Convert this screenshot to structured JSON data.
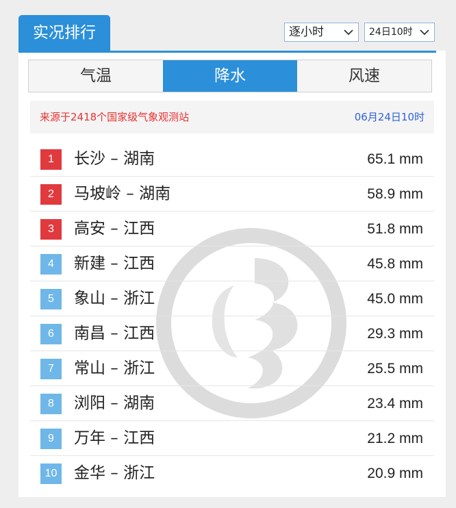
{
  "header": {
    "title": "实况排行",
    "interval_select": "逐小时",
    "time_select": "24日10时"
  },
  "tabs": [
    {
      "label": "气温",
      "active": false
    },
    {
      "label": "降水",
      "active": true
    },
    {
      "label": "风速",
      "active": false
    }
  ],
  "source": {
    "text": "来源于2418个国家级气象观测站",
    "date": "06月24日10时"
  },
  "ranking": [
    {
      "rank": "1",
      "place": "长沙 – 湖南",
      "value": "65.1 mm"
    },
    {
      "rank": "2",
      "place": "马坡岭 – 湖南",
      "value": "58.9 mm"
    },
    {
      "rank": "3",
      "place": "高安 – 江西",
      "value": "51.8 mm"
    },
    {
      "rank": "4",
      "place": "新建 – 江西",
      "value": "45.8 mm"
    },
    {
      "rank": "5",
      "place": "象山 – 浙江",
      "value": "45.0 mm"
    },
    {
      "rank": "6",
      "place": "南昌 – 江西",
      "value": "29.3 mm"
    },
    {
      "rank": "7",
      "place": "常山 – 浙江",
      "value": "25.5 mm"
    },
    {
      "rank": "8",
      "place": "浏阳 – 湖南",
      "value": "23.4 mm"
    },
    {
      "rank": "9",
      "place": "万年 – 江西",
      "value": "21.2 mm"
    },
    {
      "rank": "10",
      "place": "金华 – 浙江",
      "value": "20.9 mm"
    }
  ],
  "colors": {
    "accent": "#2b8fd9",
    "top_rank": "#e03a3e",
    "other_rank": "#6fb7e8",
    "source_text": "#e8312f",
    "source_date": "#2f62d8"
  },
  "icons": {
    "select_arrow": "chevron-down-icon",
    "watermark": "dragon-logo-watermark"
  }
}
